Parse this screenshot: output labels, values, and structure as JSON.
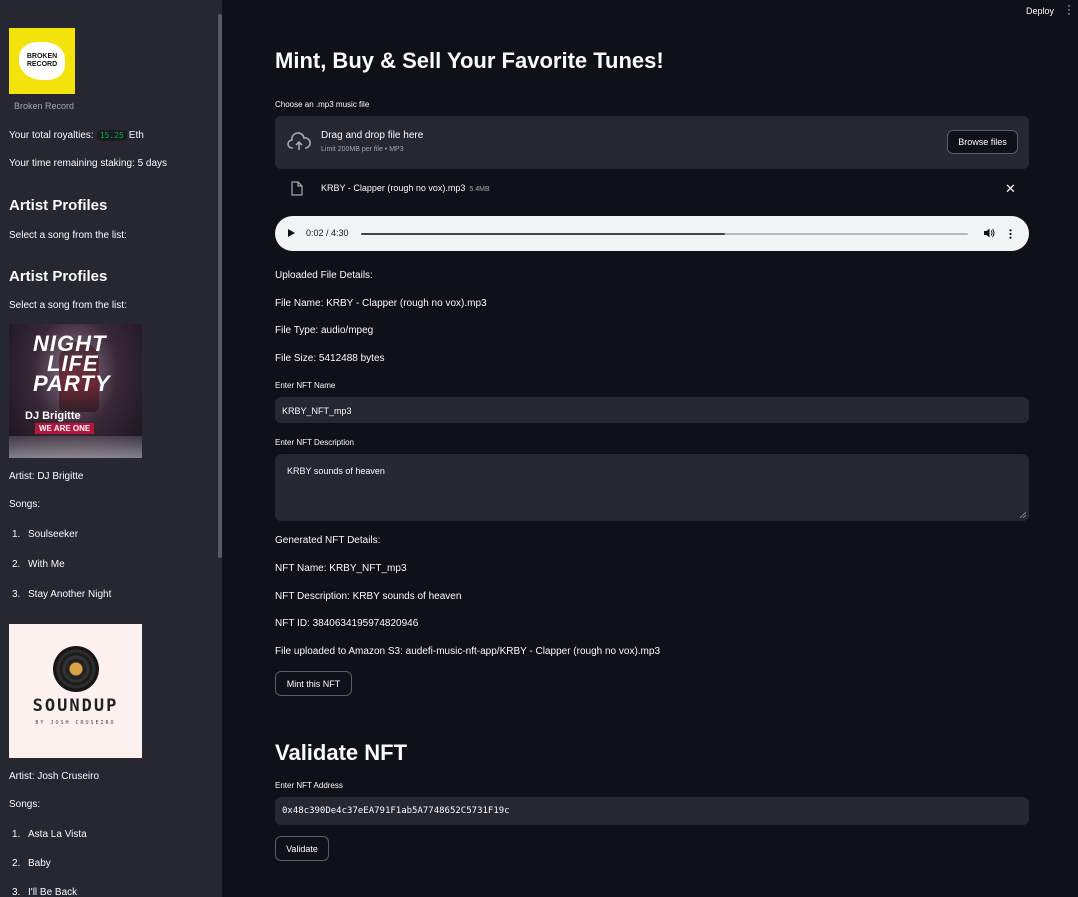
{
  "header": {
    "deploy_label": "Deploy",
    "menu_icon": "kebab-menu-icon"
  },
  "sidebar": {
    "logo_text": "BROKEN RECORD",
    "logo_caption": "Broken Record",
    "royalties_label": "Your total royalties:",
    "royalties_value": "15.25",
    "royalties_unit": "Eth",
    "staking_text": "Your time remaining staking: 5 days",
    "sections": [
      {
        "heading": "Artist Profiles",
        "prompt": "Select a song from the list:"
      },
      {
        "heading": "Artist Profiles",
        "prompt": "Select a song from the list:"
      }
    ],
    "artists": [
      {
        "cover": {
          "line1": "NIGHT",
          "line2": "LIFE",
          "line3": "PARTY",
          "name": "DJ Brigitte",
          "tag": "WE ARE ONE"
        },
        "artist_text": "Artist: DJ Brigitte",
        "songs_label": "Songs:",
        "songs": [
          "Soulseeker",
          "With Me",
          "Stay Another Night"
        ]
      },
      {
        "cover": {
          "title": "SOUNDUP",
          "by": "BY JOSH CRUSEIRO"
        },
        "artist_text": "Artist: Josh Cruseiro",
        "songs_label": "Songs:",
        "songs": [
          "Asta La Vista",
          "Baby",
          "I'll Be Back"
        ]
      }
    ]
  },
  "main": {
    "title": "Mint, Buy & Sell Your Favorite Tunes!",
    "uploader": {
      "label": "Choose an .mp3 music file",
      "drop_title": "Drag and drop file here",
      "drop_sub": "Limit 200MB per file • MP3",
      "browse_label": "Browse files",
      "file_name": "KRBY - Clapper (rough no vox).mp3",
      "file_size": "5.4MB"
    },
    "audio": {
      "time": "0:02 / 4:30",
      "progress": 0.6
    },
    "details": {
      "heading": "Uploaded File Details:",
      "name": "File Name: KRBY - Clapper (rough no vox).mp3",
      "type": "File Type: audio/mpeg",
      "size": "File Size: 5412488 bytes"
    },
    "nft_name": {
      "label": "Enter NFT Name",
      "value": "KRBY_NFT_mp3"
    },
    "nft_desc": {
      "label": "Enter NFT Description",
      "value": "KRBY sounds of heaven"
    },
    "generated": {
      "heading": "Generated NFT Details:",
      "name": "NFT Name: KRBY_NFT_mp3",
      "description": "NFT Description: KRBY sounds of heaven",
      "id": "NFT ID: 3840634195974820946",
      "s3": "File uploaded to Amazon S3: audefi-music-nft-app/KRBY - Clapper (rough no vox).mp3"
    },
    "mint_label": "Mint this NFT",
    "validate": {
      "title": "Validate NFT",
      "label": "Enter NFT Address",
      "value": "0x48c390De4c37eEA791F1ab5A7748652C5731F19c",
      "button": "Validate"
    }
  }
}
